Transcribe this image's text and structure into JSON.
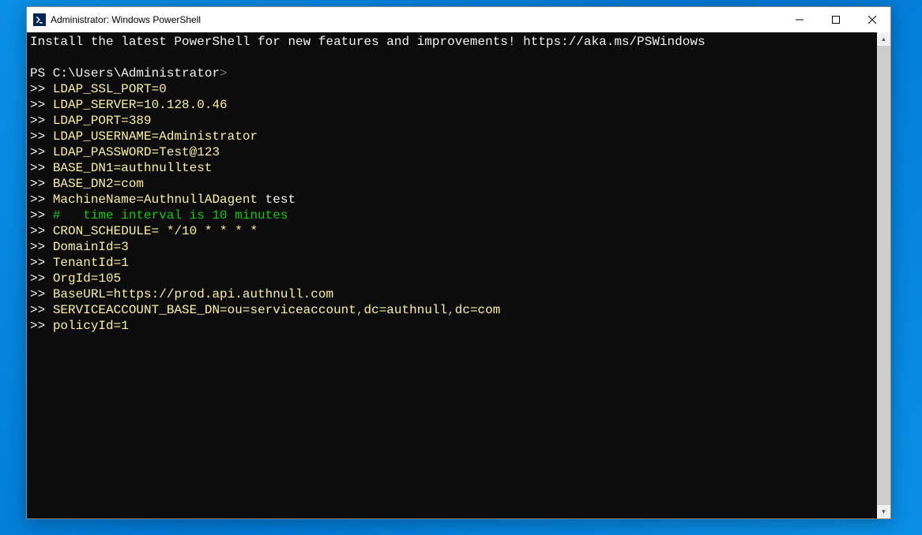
{
  "window": {
    "title": "Administrator: Windows PowerShell"
  },
  "terminal": {
    "banner": "Install the latest PowerShell for new features and improvements! https://aka.ms/PSWindows",
    "prompt_prefix": "PS ",
    "prompt_path": "C:\\Users\\Administrator",
    "prompt_suffix": ">",
    "cont": ">>",
    "lines": [
      {
        "type": "kv",
        "key": "LDAP_SSL_PORT",
        "eq": "=",
        "val": "0"
      },
      {
        "type": "kv",
        "key": "LDAP_SERVER",
        "eq": "=",
        "val": "10.128.0.46"
      },
      {
        "type": "kv",
        "key": "LDAP_PORT",
        "eq": "=",
        "val": "389"
      },
      {
        "type": "kv",
        "key": "LDAP_USERNAME",
        "eq": "=",
        "val": "Administrator"
      },
      {
        "type": "kv",
        "key": "LDAP_PASSWORD",
        "eq": "=",
        "val": "Test@123"
      },
      {
        "type": "kv",
        "key": "BASE_DN1",
        "eq": "=",
        "val": "authnulltest"
      },
      {
        "type": "kv",
        "key": "BASE_DN2",
        "eq": "=",
        "val": "com"
      },
      {
        "type": "kvtrail",
        "key": "MachineName",
        "eq": "=",
        "val": "AuthnullADagent",
        "trail": " test"
      },
      {
        "type": "comment",
        "text": "#   time interval is 10 minutes"
      },
      {
        "type": "kvw",
        "key": "CRON_SCHEDULE",
        "eq": "= ",
        "val": "*/10 * * * *"
      },
      {
        "type": "kv",
        "key": "DomainId",
        "eq": "=",
        "val": "3"
      },
      {
        "type": "kv",
        "key": "TenantId",
        "eq": "=",
        "val": "1"
      },
      {
        "type": "kv",
        "key": "OrgId",
        "eq": "=",
        "val": "105"
      },
      {
        "type": "kv",
        "key": "BaseURL",
        "eq": "=",
        "val": "https://prod.api.authnull.com"
      },
      {
        "type": "dn",
        "key": "SERVICEACCOUNT_BASE_DN",
        "eq": "=",
        "parts": [
          "ou=serviceaccount",
          ",",
          "dc=authnull",
          ",",
          "dc=com"
        ]
      },
      {
        "type": "kv",
        "key": "policyId",
        "eq": "=",
        "val": "1"
      }
    ]
  }
}
